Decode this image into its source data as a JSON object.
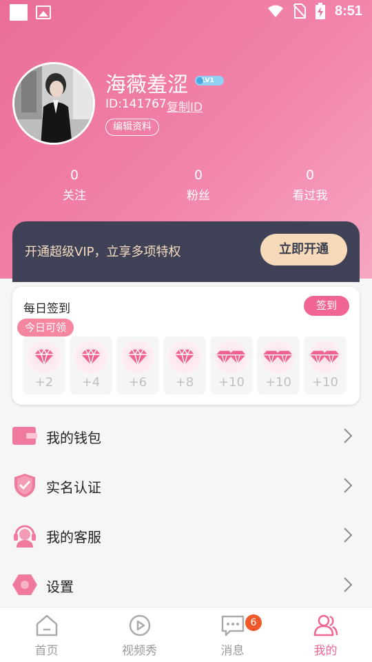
{
  "status_bar": {
    "time": "8:51"
  },
  "profile": {
    "username": "海薇羞涩",
    "level": "LV1",
    "user_id": "ID:141767",
    "copy_id_label": "复制ID",
    "edit_label": "编辑资料"
  },
  "stats": [
    {
      "value": "0",
      "label": "关注"
    },
    {
      "value": "0",
      "label": "粉丝"
    },
    {
      "value": "0",
      "label": "看过我"
    }
  ],
  "vip": {
    "text": "开通超级VIP，立享多项特权",
    "button": "立即开通"
  },
  "checkin": {
    "title": "每日签到",
    "button": "签到",
    "today_tag": "今日可领",
    "days": [
      "+2",
      "+4",
      "+6",
      "+8",
      "+10",
      "+10",
      "+10"
    ]
  },
  "menu": [
    {
      "label": "我的钱包",
      "icon": "wallet-icon"
    },
    {
      "label": "实名认证",
      "icon": "shield-check-icon"
    },
    {
      "label": "我的客服",
      "icon": "customer-service-icon"
    },
    {
      "label": "设置",
      "icon": "settings-icon"
    }
  ],
  "tabs": [
    {
      "label": "首页",
      "icon": "home-icon"
    },
    {
      "label": "视频秀",
      "icon": "video-play-icon"
    },
    {
      "label": "消息",
      "icon": "message-icon",
      "badge": "6"
    },
    {
      "label": "我的",
      "icon": "user-icon",
      "active": true
    }
  ],
  "colors": {
    "accent": "#f06592",
    "header": "#ea6d97",
    "vip_bg": "#3f4256",
    "vip_gold": "#f6dab9"
  }
}
